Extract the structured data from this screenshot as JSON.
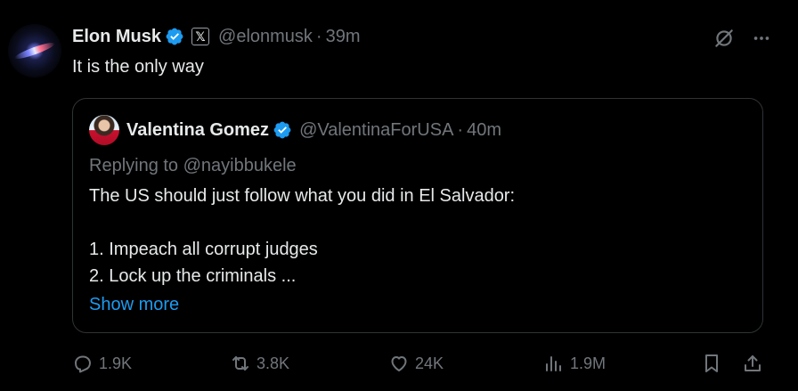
{
  "author": {
    "name": "Elon Musk",
    "badge": "𝕏",
    "handle": "@elonmusk",
    "separator": "·",
    "time": "39m"
  },
  "tweet_text": "It is the only way",
  "quote": {
    "name": "Valentina Gomez",
    "handle": "@ValentinaForUSA",
    "separator": "·",
    "time": "40m",
    "replying": "Replying to @nayibbukele",
    "lines": [
      "The US should just follow what you did in El Salvador:",
      "1. Impeach all corrupt judges",
      "2. Lock up the criminals ..."
    ],
    "show_more": "Show more"
  },
  "actions": {
    "replies": "1.9K",
    "reposts": "3.8K",
    "likes": "24K",
    "views": "1.9M"
  },
  "colors": {
    "background": "#000000",
    "text": "#e7e9ea",
    "muted": "#71767b",
    "accent": "#1d9bf0",
    "border": "#2f3336",
    "verified": "#1d9bf0"
  },
  "icons": [
    "grok-icon",
    "more-icon",
    "verified-badge-icon",
    "reply-icon",
    "repost-icon",
    "like-icon",
    "views-icon",
    "bookmark-icon",
    "share-icon"
  ]
}
